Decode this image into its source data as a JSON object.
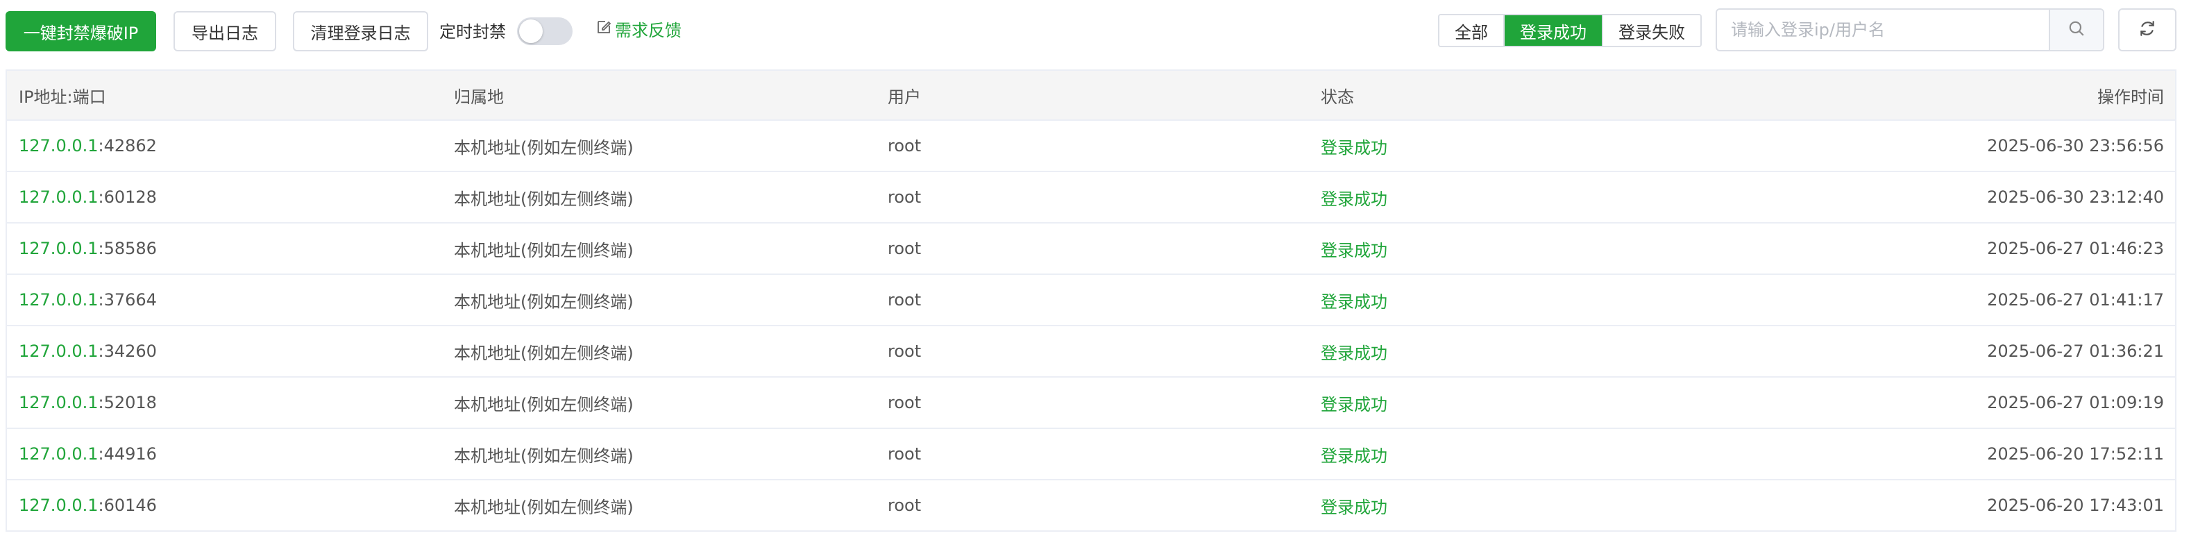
{
  "toolbar": {
    "block_button": "一键封禁爆破IP",
    "export_button": "导出日志",
    "clear_button": "清理登录日志",
    "timer_label": "定时封禁",
    "timer_enabled": false,
    "feedback_label": "需求反馈"
  },
  "filter": {
    "all": "全部",
    "success": "登录成功",
    "fail": "登录失败",
    "selected": "登录成功"
  },
  "search": {
    "placeholder": "请输入登录ip/用户名",
    "value": ""
  },
  "colors": {
    "accent": "#20a53a"
  },
  "table": {
    "headers": [
      "IP地址:端口",
      "归属地",
      "用户",
      "状态",
      "操作时间"
    ],
    "rows": [
      {
        "ip": "127.0.0.1",
        "port": ":42862",
        "location": "本机地址(例如左侧终端)",
        "user": "root",
        "status": "登录成功",
        "time": "2025-06-30 23:56:56"
      },
      {
        "ip": "127.0.0.1",
        "port": ":60128",
        "location": "本机地址(例如左侧终端)",
        "user": "root",
        "status": "登录成功",
        "time": "2025-06-30 23:12:40"
      },
      {
        "ip": "127.0.0.1",
        "port": ":58586",
        "location": "本机地址(例如左侧终端)",
        "user": "root",
        "status": "登录成功",
        "time": "2025-06-27 01:46:23"
      },
      {
        "ip": "127.0.0.1",
        "port": ":37664",
        "location": "本机地址(例如左侧终端)",
        "user": "root",
        "status": "登录成功",
        "time": "2025-06-27 01:41:17"
      },
      {
        "ip": "127.0.0.1",
        "port": ":34260",
        "location": "本机地址(例如左侧终端)",
        "user": "root",
        "status": "登录成功",
        "time": "2025-06-27 01:36:21"
      },
      {
        "ip": "127.0.0.1",
        "port": ":52018",
        "location": "本机地址(例如左侧终端)",
        "user": "root",
        "status": "登录成功",
        "time": "2025-06-27 01:09:19"
      },
      {
        "ip": "127.0.0.1",
        "port": ":44916",
        "location": "本机地址(例如左侧终端)",
        "user": "root",
        "status": "登录成功",
        "time": "2025-06-20 17:52:11"
      },
      {
        "ip": "127.0.0.1",
        "port": ":60146",
        "location": "本机地址(例如左侧终端)",
        "user": "root",
        "status": "登录成功",
        "time": "2025-06-20 17:43:01"
      }
    ]
  }
}
